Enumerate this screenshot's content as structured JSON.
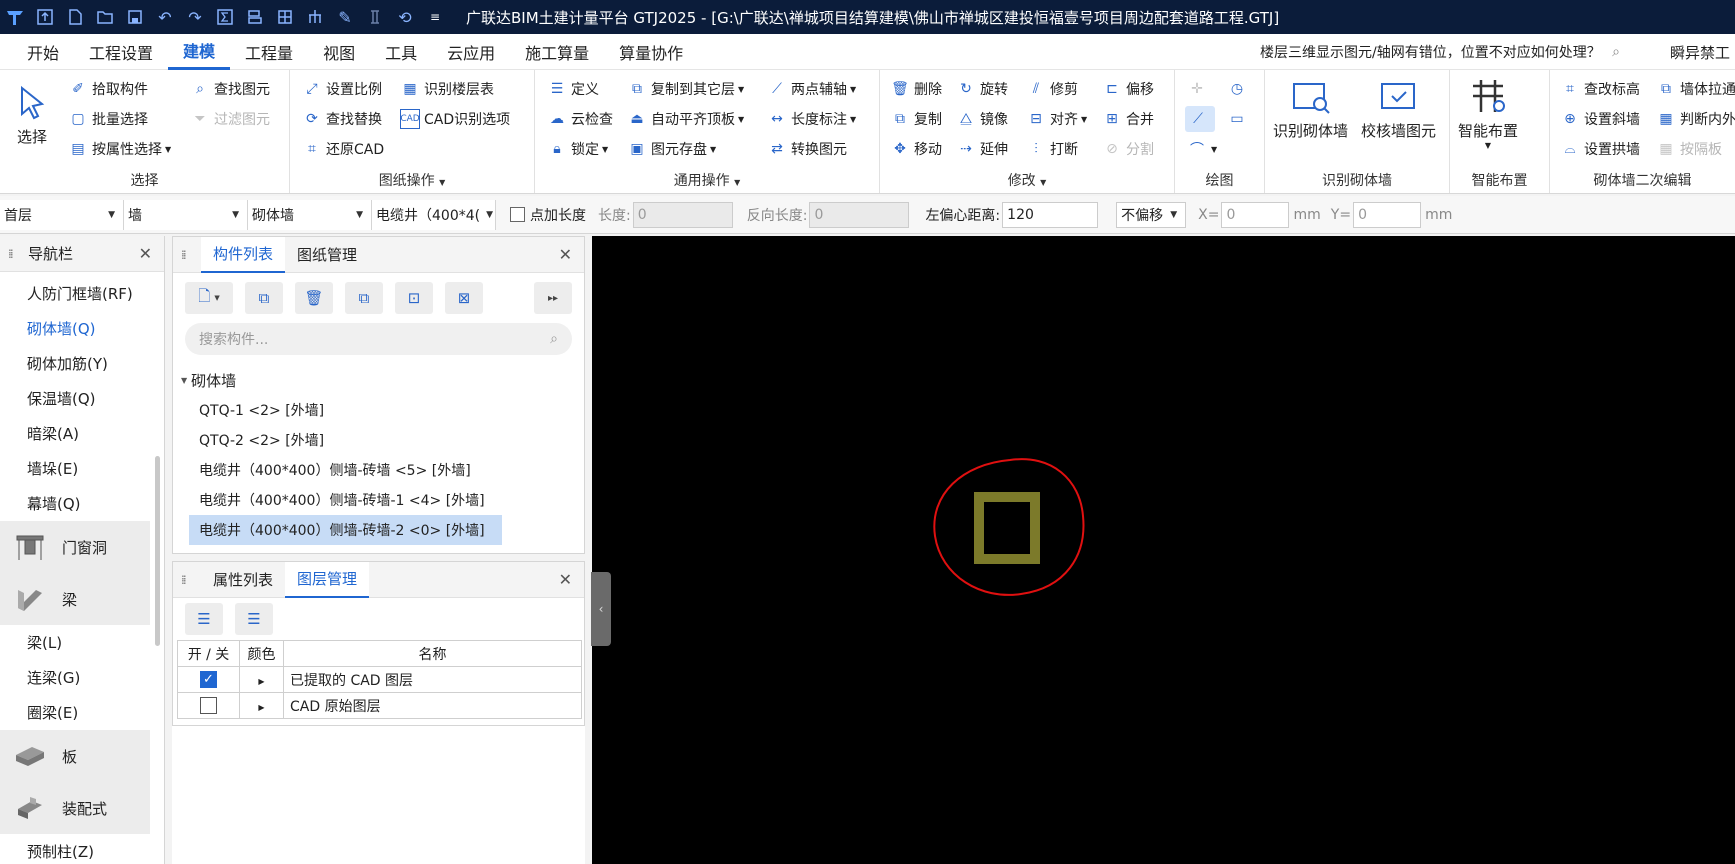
{
  "titlebar": {
    "title": "广联达BIM土建计量平台 GTJ2025 - [G:\\广联达\\禅城项目结算建模\\佛山市禅城区建投恒福壹号项目周边配套道路工程.GTJ]"
  },
  "menu": {
    "items": [
      "开始",
      "工程设置",
      "建模",
      "工程量",
      "视图",
      "工具",
      "云应用",
      "施工算量",
      "算量协作"
    ],
    "active": "建模",
    "help_text": "楼层三维显示图元/轴网有错位，位置不对应如何处理？",
    "user": "瞬异禁工"
  },
  "ribbon": {
    "select_group": {
      "label": "选择",
      "big": "选择",
      "items": [
        "拾取构件",
        "批量选择",
        "按属性选择"
      ],
      "items2": [
        "查找图元",
        "过滤图元"
      ]
    },
    "drawing_ops": {
      "label": "图纸操作",
      "items": [
        "设置比例",
        "查找替换",
        "还原CAD"
      ],
      "items2": [
        "识别楼层表",
        "CAD识别选项"
      ]
    },
    "general_ops": {
      "label": "通用操作",
      "col1": [
        "定义",
        "云检查",
        "锁定"
      ],
      "col2": [
        "复制到其它层",
        "自动平齐顶板",
        "图元存盘"
      ],
      "col3": [
        "两点辅轴",
        "长度标注",
        "转换图元"
      ]
    },
    "modify": {
      "label": "修改",
      "col1": [
        "删除",
        "复制",
        "移动"
      ],
      "col2": [
        "旋转",
        "镜像",
        "延伸"
      ],
      "col3": [
        "修剪",
        "对齐",
        "打断"
      ],
      "col4": [
        "偏移",
        "合并",
        "分割"
      ]
    },
    "draw": {
      "label": "绘图"
    },
    "recognize": {
      "label": "识别砌体墙",
      "big1": "识别砌体墙",
      "big2": "校核墙图元"
    },
    "smart": {
      "label": "智能布置",
      "big": "智能布置"
    },
    "secondary": {
      "label": "砌体墙二次编辑",
      "col1": [
        "查改标高",
        "设置斜墙",
        "设置拱墙"
      ],
      "col2": [
        "墙体拉通",
        "判断内外",
        "按隔板"
      ]
    }
  },
  "toolbar2": {
    "floor": "首层",
    "category": "墙",
    "type": "砌体墙",
    "component": "电缆井（400*4(",
    "add_length": "点加长度",
    "length_label": "长度:",
    "length_value": "0",
    "reverse_label": "反向长度:",
    "reverse_value": "0",
    "offset_label": "左偏心距离:",
    "offset_value": "120",
    "shift": "不偏移",
    "x_label": "X=",
    "x_value": "0",
    "y_label": "Y=",
    "y_value": "0",
    "unit": "mm"
  },
  "nav": {
    "title": "导航栏",
    "items_top": [
      "人防门框墙(RF)",
      "砌体墙(Q)",
      "砌体加筋(Y)",
      "保温墙(Q)",
      "暗梁(A)",
      "墙垛(E)",
      "幕墙(Q)"
    ],
    "active": "砌体墙(Q)",
    "cat_door": "门窗洞",
    "cat_beam": "梁",
    "beam_items": [
      "梁(L)",
      "连梁(G)",
      "圈梁(E)"
    ],
    "cat_slab": "板",
    "cat_prefab": "装配式",
    "prefab_items": [
      "预制柱(Z)"
    ]
  },
  "components": {
    "tab1": "构件列表",
    "tab2": "图纸管理",
    "search_placeholder": "搜索构件...",
    "root": "砌体墙",
    "items": [
      "QTQ-1 <2> [外墙]",
      "QTQ-2 <2> [外墙]",
      "电缆井（400*400）侧墙-砖墙 <5> [外墙]",
      "电缆井（400*400）侧墙-砖墙-1 <4> [外墙]",
      "电缆井（400*400）侧墙-砖墙-2 <0> [外墙]"
    ]
  },
  "layers": {
    "tab1": "属性列表",
    "tab2": "图层管理",
    "col_onoff": "开 / 关",
    "col_color": "颜色",
    "col_name": "名称",
    "rows": [
      {
        "name": "已提取的 CAD 图层",
        "on": true
      },
      {
        "name": "CAD 原始图层",
        "on": false
      }
    ]
  },
  "colors": {
    "accent": "#1f66d1",
    "title_bg": "#0b1c3a",
    "shape_fill": "#7c7a2a",
    "annotation": "#e01010"
  }
}
